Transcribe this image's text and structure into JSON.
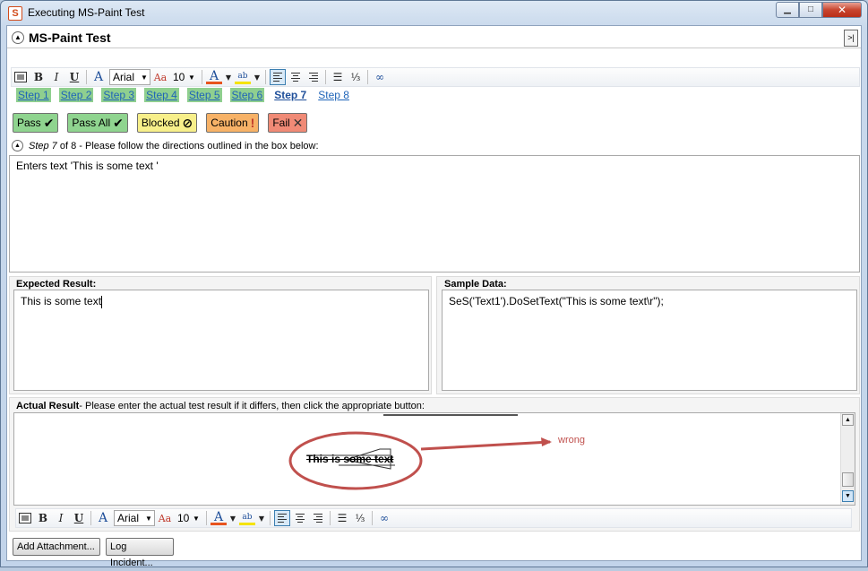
{
  "window": {
    "title": "Executing MS-Paint Test",
    "icon_letter": "S",
    "controls": {
      "minimize": "▁",
      "maximize": "□",
      "close": "✕"
    }
  },
  "header": {
    "title": "MS-Paint Test",
    "collapse_icon": "chevron-up",
    "expand_right": ">|"
  },
  "toolbar": {
    "font": "Arial",
    "size": "10",
    "icons": [
      "insert-image-icon",
      "bold-icon",
      "italic-icon",
      "underline-icon",
      "font-color-a-icon",
      "font-size-icon",
      "text-color-icon",
      "highlight-icon",
      "align-left-icon",
      "align-center-icon",
      "align-right-icon",
      "bullet-list-icon",
      "numbered-list-icon",
      "link-icon"
    ],
    "labels": {
      "bold": "B",
      "italic": "I",
      "underline": "U",
      "font_a": "A",
      "size_a": "Aa",
      "color_a": "A",
      "highlight": "ab"
    }
  },
  "steps": [
    {
      "label": "Step 1",
      "status": "done"
    },
    {
      "label": "Step 2",
      "status": "done"
    },
    {
      "label": "Step 3",
      "status": "done"
    },
    {
      "label": "Step 4",
      "status": "done"
    },
    {
      "label": "Step 5",
      "status": "done"
    },
    {
      "label": "Step 6",
      "status": "done"
    },
    {
      "label": "Step 7",
      "status": "current"
    },
    {
      "label": "Step 8",
      "status": "pending"
    }
  ],
  "status_buttons": [
    {
      "label": "Pass",
      "glyph": "✔",
      "bg": "#8fd48f"
    },
    {
      "label": "Pass All",
      "glyph": "✔",
      "bg": "#8fd48f"
    },
    {
      "label": "Blocked",
      "glyph": "⊘",
      "bg": "#f7ef8a"
    },
    {
      "label": "Caution",
      "glyph": "!",
      "bg": "#f7b267"
    },
    {
      "label": "Fail",
      "glyph": "✕",
      "bg": "#f08a76"
    }
  ],
  "instruction": {
    "step_word": "Step 7",
    "of_text": "of 8",
    "text": "- Please follow the directions outlined in the box below:"
  },
  "description": {
    "text": "Enters text 'This is some text '"
  },
  "expected": {
    "label": "Expected Result:",
    "text": "This is some text"
  },
  "sample": {
    "label": "Sample Data:",
    "text": "SeS('Text1').DoSetText(\"This is some text\\r\");"
  },
  "actual": {
    "label": "Actual Result",
    "hint": "- Please enter the actual test result if it differs, then click the appropriate button:",
    "image_text": "This is some text",
    "annotation": "wrong",
    "annotation_color": "#c0504d"
  },
  "bottom_buttons": {
    "attach": "Add Attachment...",
    "incident": "Log Incident..."
  }
}
